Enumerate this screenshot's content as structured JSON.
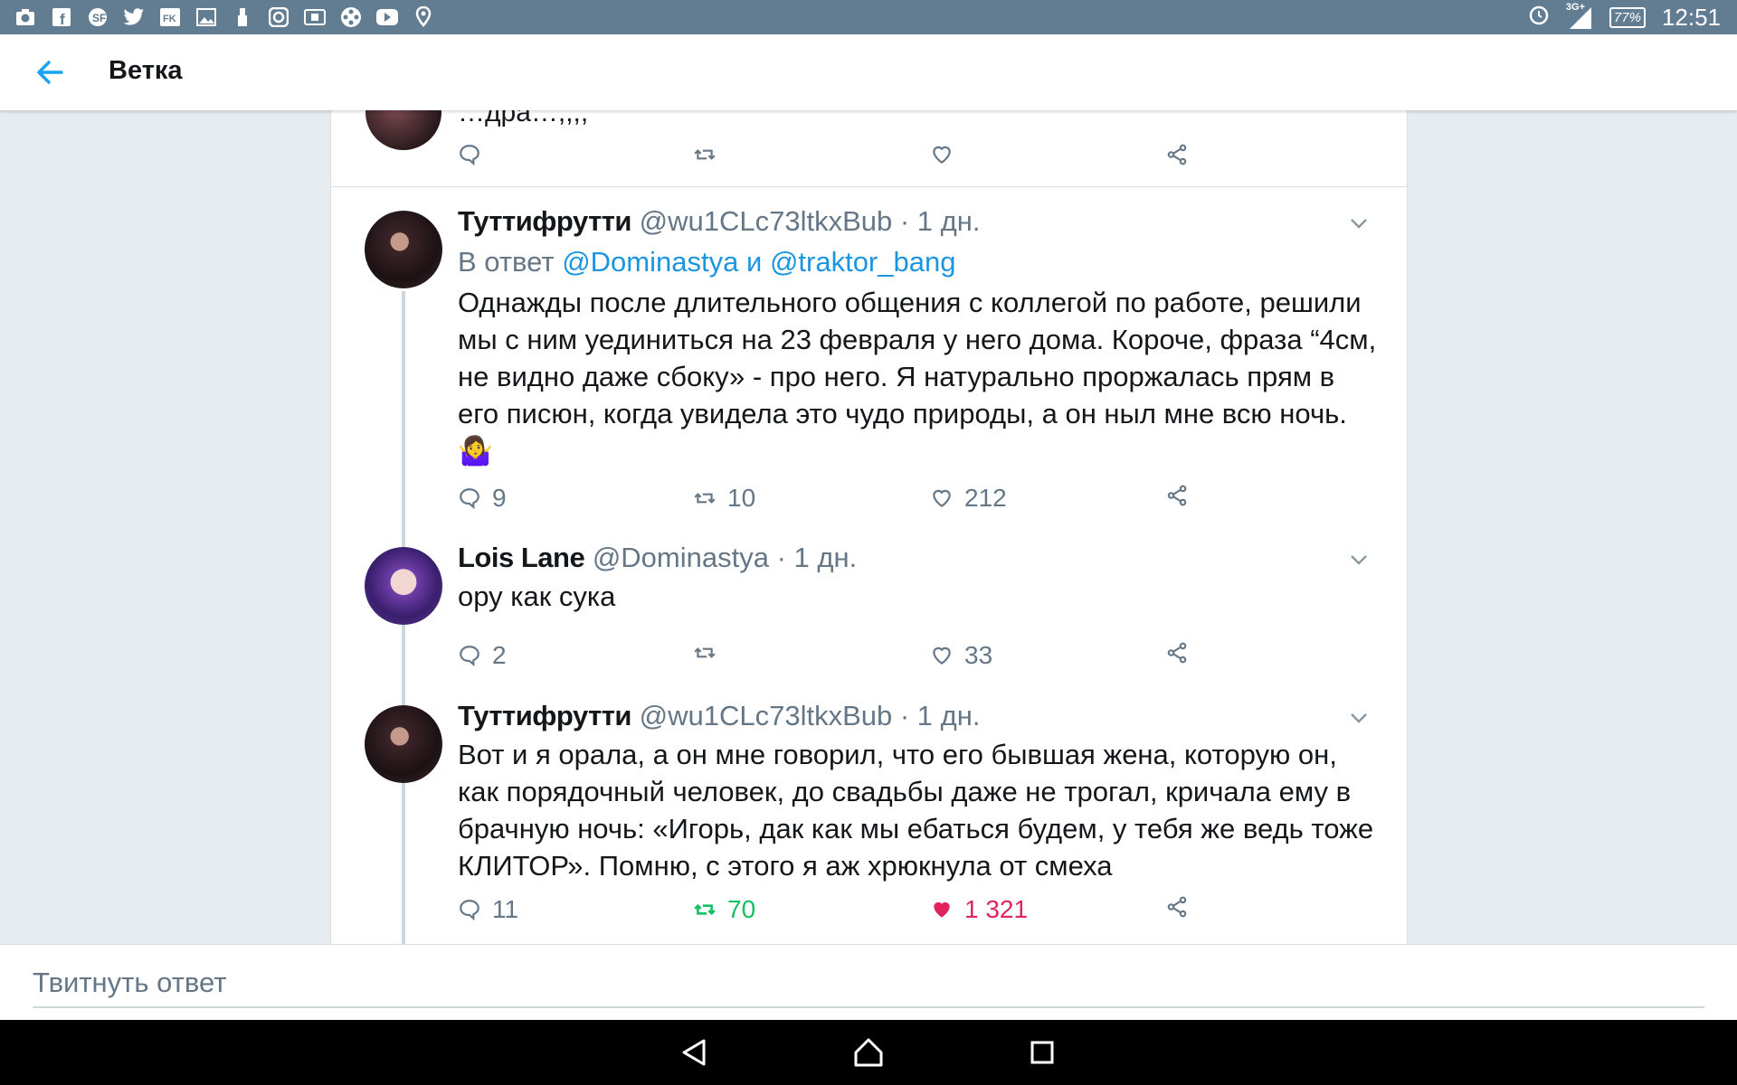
{
  "statusbar": {
    "icons": [
      "camera-icon",
      "facebook-icon",
      "soundcloud-icon",
      "twitter-icon",
      "vk-icon",
      "image-icon",
      "usb-icon",
      "instagram-icon",
      "sd-card-icon",
      "film-reel-icon",
      "youtube-icon",
      "location-icon"
    ],
    "network": "3G+",
    "battery": "77%",
    "time": "12:51"
  },
  "appbar": {
    "title": "Ветка"
  },
  "partial_tweet": {
    "text": "…дра…,,,,"
  },
  "tweets": [
    {
      "name": "Туттифрутти",
      "handle": "@wu1CLc73ltkxBub",
      "time": "· 1 дн.",
      "reply_prefix": "В ответ",
      "reply_user1": "@Dominastya",
      "reply_and": "и",
      "reply_user2": "@traktor_bang",
      "text": "Однажды после длительного общения с коллегой по работе, решили мы с ним уединиться на 23 февраля у него дома. Короче, фраза “4см, не видно даже сбоку» - про него. Я натурально проржалась прям в его писюн, когда увидела это чудо природы, а он ныл мне всю ночь. 🤷‍♀️",
      "replies": "9",
      "retweets": "10",
      "likes": "212"
    },
    {
      "name": "Lois Lane",
      "handle": "@Dominastya",
      "time": "· 1 дн.",
      "text": "ору как сука",
      "replies": "2",
      "retweets": "",
      "likes": "33"
    },
    {
      "name": "Туттифрутти",
      "handle": "@wu1CLc73ltkxBub",
      "time": "· 1 дн.",
      "text": "Вот и я орала, а он мне говорил, что его бывшая жена, которую он, как порядочный человек, до свадьбы даже не трогал, кричала ему в брачную ночь: «Игорь, дак как мы ебаться будем, у тебя же ведь тоже КЛИТОР». Помню, с этого я аж хрюкнула от смеха",
      "replies": "11",
      "retweets": "70",
      "likes": "1 321"
    }
  ],
  "compose": {
    "placeholder": "Твитнуть ответ"
  },
  "colors": {
    "accent": "#1b95e0",
    "retweet": "#17bf63",
    "like": "#e0245e",
    "statusbar": "#627c92",
    "secondary_text": "#657786"
  }
}
